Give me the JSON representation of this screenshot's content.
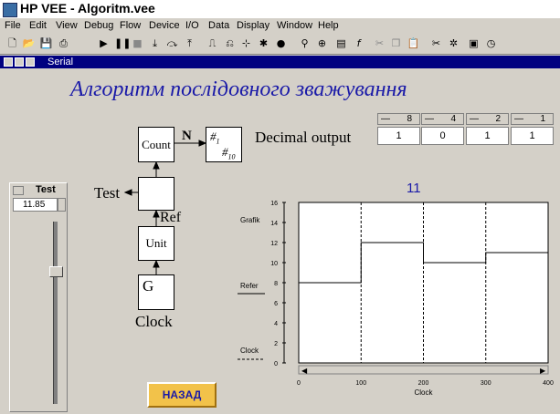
{
  "app": {
    "title": "HP VEE - Algoritm.vee"
  },
  "menu": [
    "File",
    "Edit",
    "View",
    "Debug",
    "Flow",
    "Device",
    "I/O",
    "Data",
    "Display",
    "Window",
    "Help"
  ],
  "toolbar_icons": [
    "new-icon",
    "open-icon",
    "save-icon",
    "print-icon",
    "run-icon",
    "pause-icon",
    "stop-icon",
    "step-into-icon",
    "step-over-icon",
    "step-out-icon",
    "show-data-flow-icon",
    "show-exec-flow-icon",
    "line-probe-icon",
    "breakpoint-icon",
    "clear-breakpoints-icon",
    "find-icon",
    "zoom-icon",
    "properties-icon",
    "function-icon",
    "cut-icon",
    "copy-icon",
    "paste-icon",
    "delete-line-icon",
    "cleanup-icon",
    "panel-view-icon",
    "timer-icon"
  ],
  "window": {
    "title": "Serial"
  },
  "heading": "Алгоритм послідовного зважування",
  "diagram": {
    "count": "Count",
    "n_label": "N",
    "decimal_output": "Decimal output",
    "test_label": "Test",
    "ref_label": "Ref",
    "unit": "Unit",
    "g": "G",
    "clock": "Clock",
    "dec_top": "#",
    "dec_top_sub": "1",
    "dec_bottom": "#",
    "dec_bottom_sub": "10"
  },
  "counter": {
    "headers": [
      "8",
      "4",
      "2",
      "1"
    ],
    "values": [
      "1",
      "0",
      "1",
      "1"
    ]
  },
  "slider": {
    "title": "Test",
    "value": "11.85",
    "level": 11.85,
    "min": 0,
    "max": 16
  },
  "back_button": "НАЗАД",
  "colors": {
    "accent": "#1a1aa8",
    "button": "#f2c24a",
    "window_title": "#000080"
  },
  "chart_data": {
    "type": "line",
    "title": "11",
    "xlabel": "Clock",
    "xlim": [
      0,
      400
    ],
    "ylim": [
      0,
      16
    ],
    "xticks": [
      0,
      100,
      200,
      300,
      400
    ],
    "yticks": [
      0,
      2,
      4,
      6,
      8,
      10,
      12,
      14,
      16
    ],
    "legend": [
      "Grafik",
      "Refer",
      "Clock"
    ],
    "series": [
      {
        "name": "Grafik",
        "x": [
          0,
          100,
          100,
          200,
          200,
          300,
          300,
          400
        ],
        "y": [
          8,
          8,
          12,
          12,
          10,
          10,
          11,
          11
        ]
      },
      {
        "name": "Clock",
        "x": [
          100,
          200,
          300
        ],
        "y": [
          0,
          0,
          0
        ]
      }
    ]
  }
}
